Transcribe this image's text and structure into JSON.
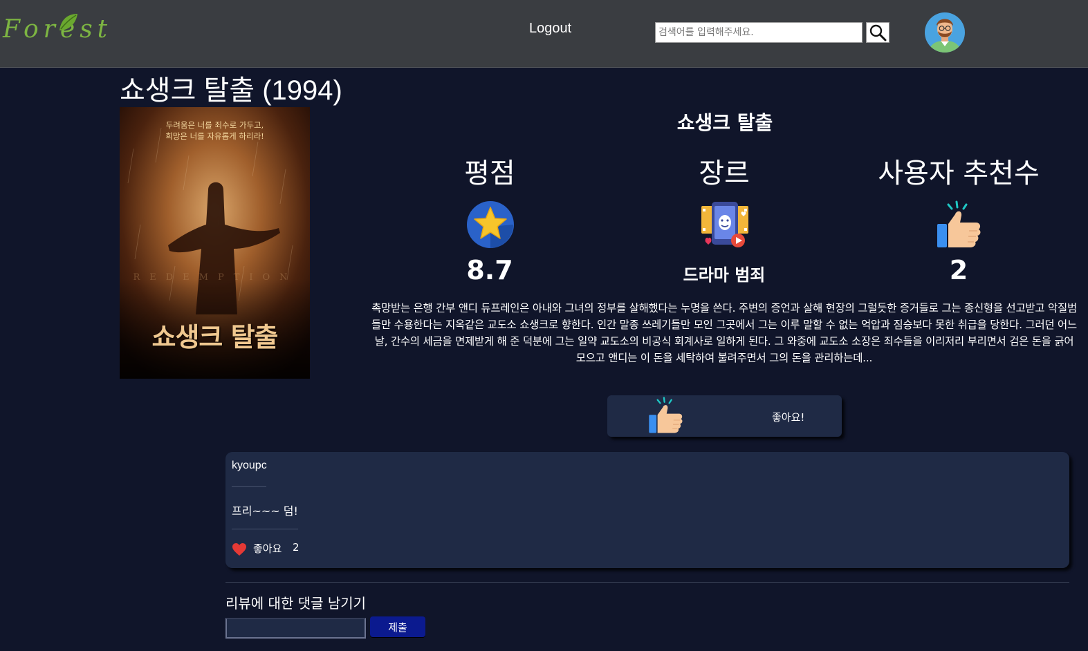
{
  "header": {
    "logo_text": "Forest",
    "logout_label": "Logout",
    "search": {
      "placeholder": "검색어를 입력해주세요.",
      "value": ""
    },
    "search_icon": "search-icon",
    "avatar_icon": "user-avatar"
  },
  "movie": {
    "title": "쇼생크 탈출 (1994)",
    "subtitle": "쇼생크 탈출",
    "poster": {
      "tagline": "두려움은 너를 죄수로 가두고,\n희망은 너를 자유롭게 하리라!",
      "title": "쇼생크 탈출"
    },
    "stats": {
      "rating": {
        "label": "평점",
        "value": "8.7",
        "icon": "star-icon"
      },
      "genre": {
        "label": "장르",
        "value": "드라마 범죄",
        "icon": "genre-icon"
      },
      "recommend": {
        "label": "사용자 추천수",
        "value": "2",
        "icon": "thumbs-up-icon"
      }
    },
    "plot": "촉망받는 은행 간부 앤디 듀프레인은 아내와 그녀의 정부를 살해했다는 누명을 쓴다. 주변의 증언과 살해 현장의 그럴듯한 증거들로 그는 종신형을 선고받고 악질범들만 수용한다는 지옥같은 교도소 쇼생크로 향한다. 인간 말종 쓰레기들만 모인 그곳에서 그는 이루 말할 수 없는 억압과 짐승보다 못한 취급을 당한다. 그러던 어느 날, 간수의 세금을 면제받게 해 준 덕분에 그는 일약 교도소의 비공식 회계사로 일하게 된다. 그 와중에 교도소 소장은 죄수들을 이리저리 부리면서 검은 돈을 긁어 모으고 앤디는 이 돈을 세탁하여 불려주면서 그의 돈을 관리하는데...",
    "like_button_label": "좋아요!"
  },
  "review": {
    "author": "kyoupc",
    "body": "프리~~~ 덤!",
    "like_label": "좋아요",
    "like_count": "2",
    "heart_icon": "heart-icon"
  },
  "comment": {
    "label": "리뷰에 대한 댓글 남기기",
    "input_value": "",
    "submit_label": "제출"
  },
  "colors": {
    "background": "#10152a",
    "header": "#3a3d41",
    "card": "#1f2a45",
    "logo_green": "#7db542",
    "submit": "#0b1a8f",
    "heart": "#e53935"
  }
}
